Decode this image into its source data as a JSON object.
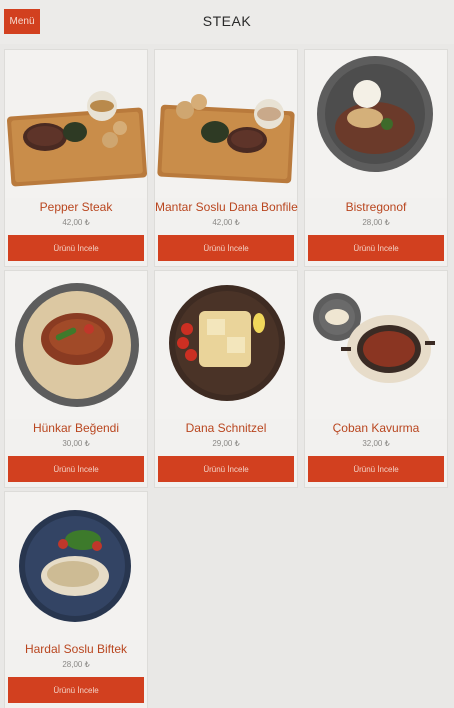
{
  "header": {
    "menu_label": "Menü",
    "title": "STEAK"
  },
  "products": [
    {
      "name": "Pepper Steak",
      "price": "42,00 ₺",
      "button": "Ürünü İncele",
      "image": "pepper-steak-board"
    },
    {
      "name": "Mantar Soslu Dana Bonfile",
      "price": "42,00 ₺",
      "button": "Ürünü İncele",
      "image": "mushroom-beef-board"
    },
    {
      "name": "Bistregonof",
      "price": "28,00 ₺",
      "button": "Ürünü İncele",
      "image": "stroganoff-plate"
    },
    {
      "name": "Hünkar Beğendi",
      "price": "30,00 ₺",
      "button": "Ürünü İncele",
      "image": "hunkar-plate"
    },
    {
      "name": "Dana Schnitzel",
      "price": "29,00 ₺",
      "button": "Ürünü İncele",
      "image": "schnitzel-plate"
    },
    {
      "name": "Çoban Kavurma",
      "price": "32,00 ₺",
      "button": "Ürünü İncele",
      "image": "kavurma-pan"
    },
    {
      "name": "Hardal Soslu Biftek",
      "price": "28,00 ₺",
      "button": "Ürünü İncele",
      "image": "mustard-steak-plate"
    }
  ],
  "colors": {
    "accent": "#d2401f",
    "name_text": "#b9461f",
    "background": "#e9e8e6"
  }
}
